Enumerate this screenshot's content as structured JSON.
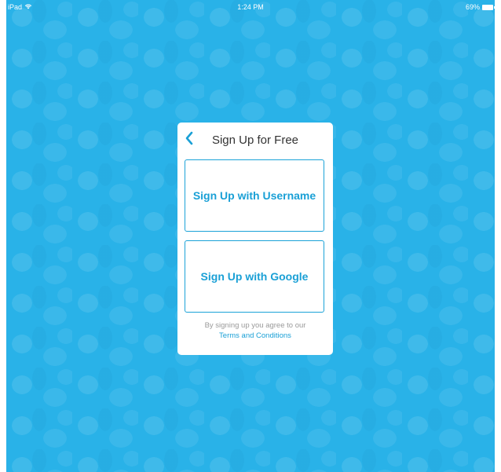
{
  "status_bar": {
    "device": "iPad",
    "wifi_icon": "wifi-icon",
    "time": "1:24 PM",
    "battery_percent": "69%",
    "battery_icon": "battery-icon"
  },
  "dialog": {
    "back_icon": "chevron-left-icon",
    "title": "Sign Up for Free",
    "username_button_label": "Sign Up with Username",
    "google_button_label": "Sign Up with Google",
    "agreement_text": "By signing up you agree to our",
    "terms_link": "Terms and Conditions"
  },
  "colors": {
    "background": "#29b2e8",
    "accent": "#1aa0d6",
    "dialog_background": "#ffffff"
  }
}
